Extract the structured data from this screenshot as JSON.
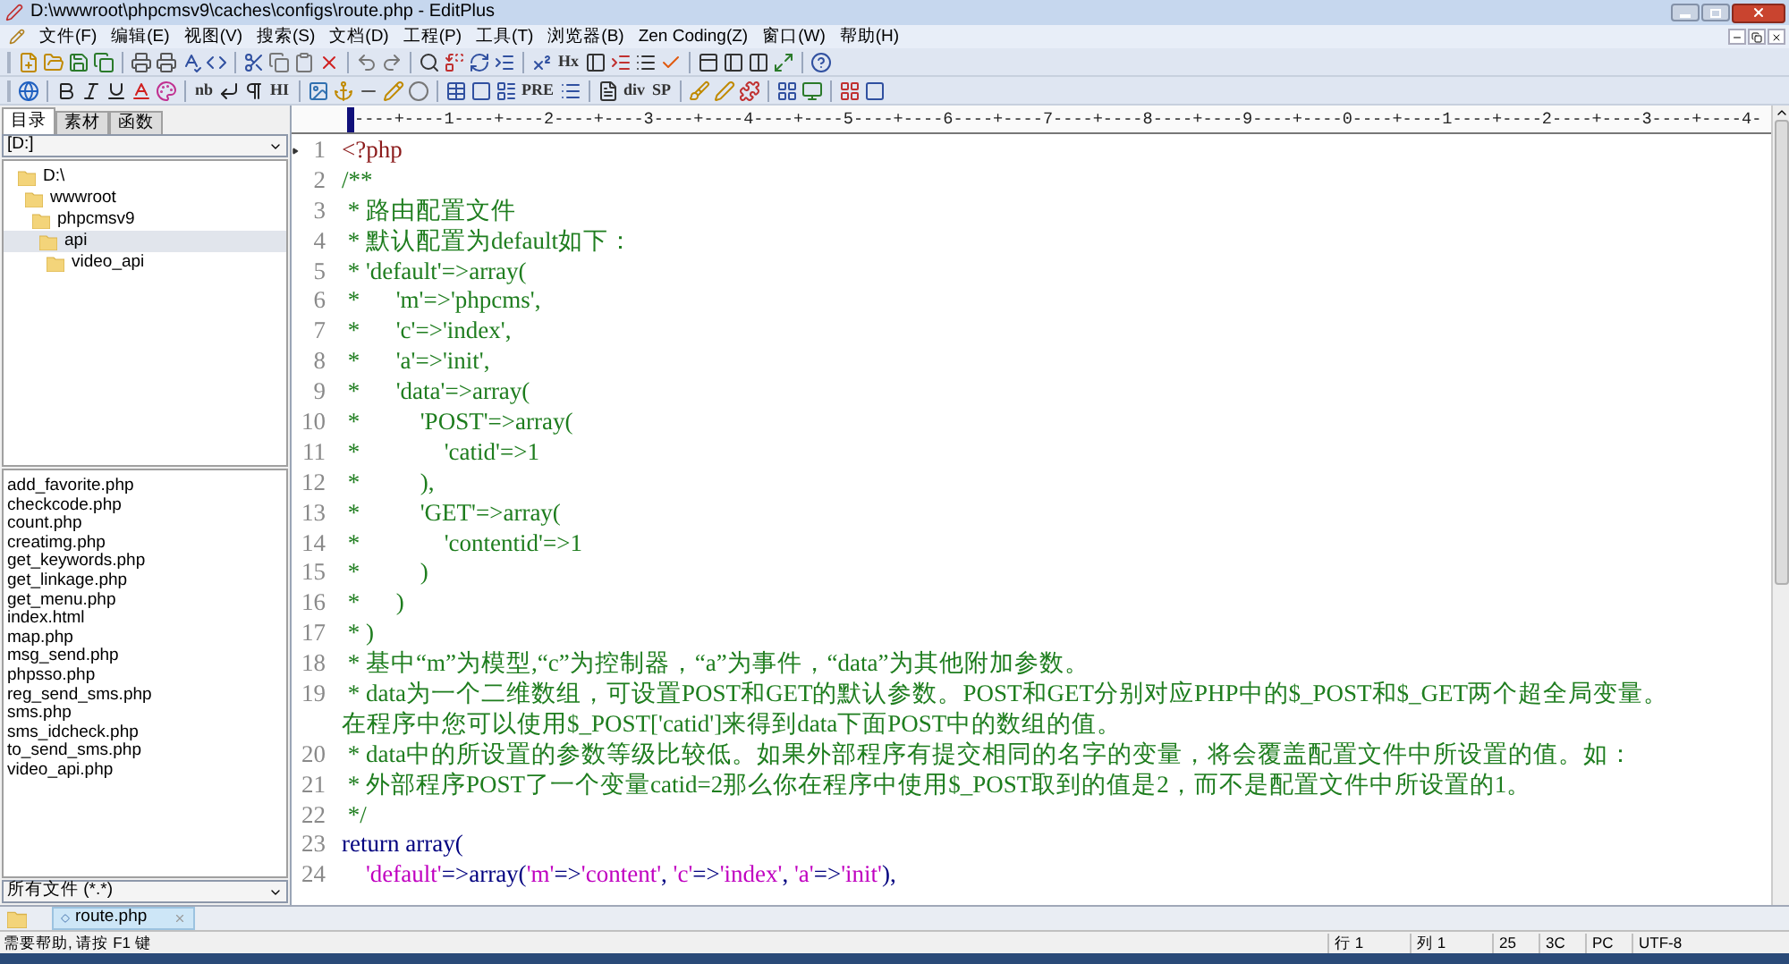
{
  "window": {
    "title": "D:\\wwwroot\\phpcmsv9\\caches\\configs\\route.php - EditPlus"
  },
  "menu": [
    "文件(F)",
    "编辑(E)",
    "视图(V)",
    "搜索(S)",
    "文档(D)",
    "工程(P)",
    "工具(T)",
    "浏览器(B)",
    "Zen Coding(Z)",
    "窗口(W)",
    "帮助(H)"
  ],
  "toolbar_labels": {
    "main": [
      "Hx"
    ],
    "html": [
      "nb",
      "HI",
      "PRE",
      "div",
      "SP"
    ]
  },
  "sidebar": {
    "tabs": [
      {
        "label": "目录",
        "selected": true
      },
      {
        "label": "素材",
        "selected": false
      },
      {
        "label": "函数",
        "selected": false
      }
    ],
    "drive": "[D:]",
    "tree": [
      {
        "label": "D:\\",
        "selected": false,
        "children": [
          {
            "label": "wwwroot",
            "selected": false,
            "children": [
              {
                "label": "phpcmsv9",
                "selected": false,
                "children": [
                  {
                    "label": "api",
                    "selected": true,
                    "children": [
                      {
                        "label": "video_api",
                        "selected": false
                      }
                    ]
                  }
                ]
              }
            ]
          }
        ]
      }
    ],
    "files": [
      "add_favorite.php",
      "checkcode.php",
      "count.php",
      "creatimg.php",
      "get_keywords.php",
      "get_linkage.php",
      "get_menu.php",
      "index.html",
      "map.php",
      "msg_send.php",
      "phpsso.php",
      "reg_send_sms.php",
      "sms.php",
      "sms_idcheck.php",
      "to_send_sms.php",
      "video_api.php"
    ],
    "filter": "所有文件 (*.*)"
  },
  "ruler": "----+----1----+----2----+----3----+----4----+----5----+----6----+----7----+----8----+----9----+----0----+----1----+----2----+----3----+----4-",
  "code": [
    {
      "n": "1",
      "current": true,
      "rows": [
        [
          {
            "kind": "tag",
            "text": "<?php"
          }
        ]
      ]
    },
    {
      "n": "2",
      "current": false,
      "rows": [
        [
          {
            "kind": "comment",
            "text": "/**"
          }
        ]
      ]
    },
    {
      "n": "3",
      "current": false,
      "rows": [
        [
          {
            "kind": "comment",
            "text": " * 路由配置文件"
          }
        ]
      ]
    },
    {
      "n": "4",
      "current": false,
      "rows": [
        [
          {
            "kind": "comment",
            "text": " * 默认配置为default如下："
          }
        ]
      ]
    },
    {
      "n": "5",
      "current": false,
      "rows": [
        [
          {
            "kind": "comment",
            "text": " * 'default'=>array("
          }
        ]
      ]
    },
    {
      "n": "6",
      "current": false,
      "rows": [
        [
          {
            "kind": "comment",
            "text": " *      'm'=>'phpcms',"
          }
        ]
      ]
    },
    {
      "n": "7",
      "current": false,
      "rows": [
        [
          {
            "kind": "comment",
            "text": " *      'c'=>'index',"
          }
        ]
      ]
    },
    {
      "n": "8",
      "current": false,
      "rows": [
        [
          {
            "kind": "comment",
            "text": " *      'a'=>'init',"
          }
        ]
      ]
    },
    {
      "n": "9",
      "current": false,
      "rows": [
        [
          {
            "kind": "comment",
            "text": " *      'data'=>array("
          }
        ]
      ]
    },
    {
      "n": "10",
      "current": false,
      "rows": [
        [
          {
            "kind": "comment",
            "text": " *          'POST'=>array("
          }
        ]
      ]
    },
    {
      "n": "11",
      "current": false,
      "rows": [
        [
          {
            "kind": "comment",
            "text": " *              'catid'=>1"
          }
        ]
      ]
    },
    {
      "n": "12",
      "current": false,
      "rows": [
        [
          {
            "kind": "comment",
            "text": " *          ),"
          }
        ]
      ]
    },
    {
      "n": "13",
      "current": false,
      "rows": [
        [
          {
            "kind": "comment",
            "text": " *          'GET'=>array("
          }
        ]
      ]
    },
    {
      "n": "14",
      "current": false,
      "rows": [
        [
          {
            "kind": "comment",
            "text": " *              'contentid'=>1"
          }
        ]
      ]
    },
    {
      "n": "15",
      "current": false,
      "rows": [
        [
          {
            "kind": "comment",
            "text": " *          )"
          }
        ]
      ]
    },
    {
      "n": "16",
      "current": false,
      "rows": [
        [
          {
            "kind": "comment",
            "text": " *      )"
          }
        ]
      ]
    },
    {
      "n": "17",
      "current": false,
      "rows": [
        [
          {
            "kind": "comment",
            "text": " * )"
          }
        ]
      ]
    },
    {
      "n": "18",
      "current": false,
      "rows": [
        [
          {
            "kind": "comment",
            "text": " * 基中“m”为模型,“c”为控制器，“a”为事件，“data”为其他附加参数。"
          }
        ]
      ]
    },
    {
      "n": "19",
      "current": false,
      "rows": [
        [
          {
            "kind": "comment",
            "text": " * data为一个二维数组，可设置POST和GET的默认参数。POST和GET分别对应PHP中的$_POST和$_GET两个超全局变量。"
          }
        ],
        [
          {
            "kind": "comment",
            "text": "在程序中您可以使用$_POST['catid']来得到data下面POST中的数组的值。"
          }
        ]
      ]
    },
    {
      "n": "20",
      "current": false,
      "rows": [
        [
          {
            "kind": "comment",
            "text": " * data中的所设置的参数等级比较低。如果外部程序有提交相同的名字的变量，将会覆盖配置文件中所设置的值。如："
          }
        ]
      ]
    },
    {
      "n": "21",
      "current": false,
      "rows": [
        [
          {
            "kind": "comment",
            "text": " * 外部程序POST了一个变量catid=2那么你在程序中使用$_POST取到的值是2，而不是配置文件中所设置的1。"
          }
        ]
      ]
    },
    {
      "n": "22",
      "current": false,
      "rows": [
        [
          {
            "kind": "comment",
            "text": " */"
          }
        ]
      ]
    },
    {
      "n": "23",
      "current": false,
      "rows": [
        [
          {
            "kind": "keyword",
            "text": "return array("
          }
        ]
      ]
    },
    {
      "n": "24",
      "current": false,
      "rows": [
        [
          {
            "kind": "plain",
            "text": "    "
          },
          {
            "kind": "string",
            "text": "'default'"
          },
          {
            "kind": "keyword",
            "text": "=>array("
          },
          {
            "kind": "string",
            "text": "'m'"
          },
          {
            "kind": "keyword",
            "text": "=>"
          },
          {
            "kind": "string",
            "text": "'content'"
          },
          {
            "kind": "keyword",
            "text": ", "
          },
          {
            "kind": "string",
            "text": "'c'"
          },
          {
            "kind": "keyword",
            "text": "=>"
          },
          {
            "kind": "string",
            "text": "'index'"
          },
          {
            "kind": "keyword",
            "text": ", "
          },
          {
            "kind": "string",
            "text": "'a'"
          },
          {
            "kind": "keyword",
            "text": "=>"
          },
          {
            "kind": "string",
            "text": "'init'"
          },
          {
            "kind": "keyword",
            "text": "),"
          }
        ]
      ]
    }
  ],
  "doc_tabs": [
    {
      "label": "route.php",
      "selected": true
    }
  ],
  "status_bar": {
    "help": "需要帮助, 请按 F1 键",
    "cells": [
      "行 1",
      "列 1",
      "25",
      "3C",
      "PC",
      "UTF-8"
    ]
  }
}
